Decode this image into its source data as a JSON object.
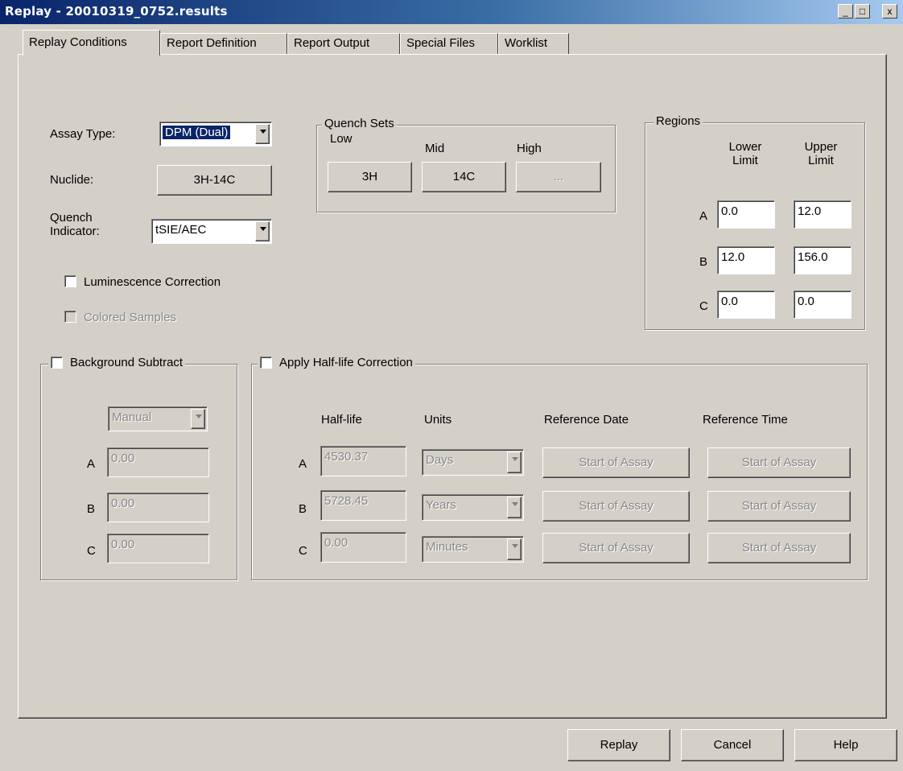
{
  "window": {
    "title": "Replay - 20010319_0752.results",
    "controls": {
      "minimize": "_",
      "maximize": "□",
      "close": "x"
    }
  },
  "tabs": [
    "Replay Conditions",
    "Report Definition",
    "Report Output",
    "Special Files",
    "Worklist"
  ],
  "active_tab": "Replay Conditions",
  "assay": {
    "assay_type_label": "Assay Type:",
    "assay_type_value": "DPM (Dual)",
    "nuclide_label": "Nuclide:",
    "nuclide_value": "3H-14C",
    "quench_indicator_label_line1": "Quench",
    "quench_indicator_label_line2": "Indicator:",
    "quench_indicator_value": "tSIE/AEC",
    "luminescence_label": "Luminescence Correction",
    "luminescence_checked": false,
    "colored_samples_label": "Colored Samples",
    "colored_samples_checked": false
  },
  "quench_sets": {
    "title": "Quench Sets",
    "low_label": "Low",
    "mid_label": "Mid",
    "high_label": "High",
    "low_value": "3H",
    "mid_value": "14C",
    "high_value": "..."
  },
  "regions": {
    "title": "Regions",
    "lower_label_line1": "Lower",
    "lower_label_line2": "Limit",
    "upper_label_line1": "Upper",
    "upper_label_line2": "Limit",
    "rows": [
      {
        "name": "A",
        "lower": "0.0",
        "upper": "12.0"
      },
      {
        "name": "B",
        "lower": "12.0",
        "upper": "156.0"
      },
      {
        "name": "C",
        "lower": "0.0",
        "upper": "0.0"
      }
    ]
  },
  "background_subtract": {
    "title": "Background Subtract",
    "checked": false,
    "mode": "Manual",
    "rows": [
      {
        "name": "A",
        "value": "0.00"
      },
      {
        "name": "B",
        "value": "0.00"
      },
      {
        "name": "C",
        "value": "0.00"
      }
    ]
  },
  "halflife": {
    "title": "Apply Half-life Correction",
    "checked": false,
    "headers": {
      "halflife": "Half-life",
      "units": "Units",
      "ref_date": "Reference Date",
      "ref_time": "Reference Time"
    },
    "rows": [
      {
        "name": "A",
        "halflife": "4530.37",
        "units": "Days",
        "ref_date": "Start of Assay",
        "ref_time": "Start of Assay"
      },
      {
        "name": "B",
        "halflife": "5728.45",
        "units": "Years",
        "ref_date": "Start of Assay",
        "ref_time": "Start of Assay"
      },
      {
        "name": "C",
        "halflife": "0.00",
        "units": "Minutes",
        "ref_date": "Start of Assay",
        "ref_time": "Start of Assay"
      }
    ]
  },
  "footer": {
    "replay_label": "Replay",
    "cancel_label": "Cancel",
    "help_label": "Help"
  }
}
